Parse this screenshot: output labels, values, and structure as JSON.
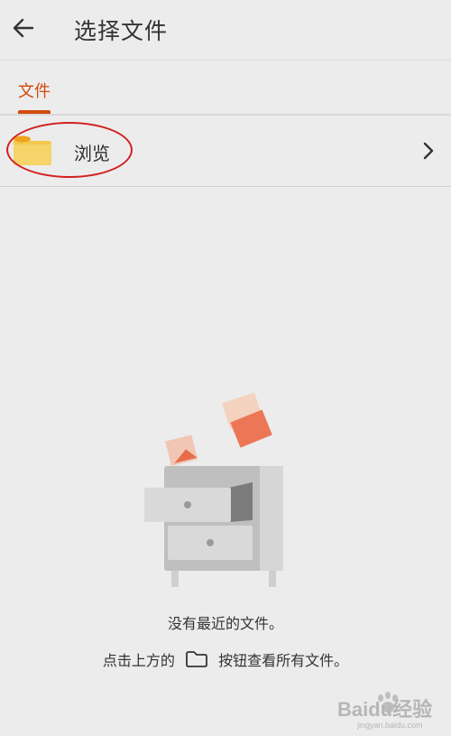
{
  "appbar": {
    "title": "选择文件",
    "back_icon": "arrow-left-icon"
  },
  "tabs": [
    {
      "label": "文件",
      "active": true
    }
  ],
  "browse": {
    "label": "浏览",
    "icon": "folder-icon",
    "chevron": "chevron-right-icon"
  },
  "empty_state": {
    "message": "没有最近的文件。",
    "hint_before": "点击上方的",
    "hint_icon": "folder-outline-icon",
    "hint_after": "按钮查看所有文件。"
  },
  "watermark": {
    "text": "Baidu经验",
    "subtext": "jingyan.baidu.com"
  },
  "colors": {
    "background": "#ececec",
    "accent": "#d24b0c",
    "annotation_circle": "#d21f1f",
    "folder_yellow": "#f4c542"
  }
}
